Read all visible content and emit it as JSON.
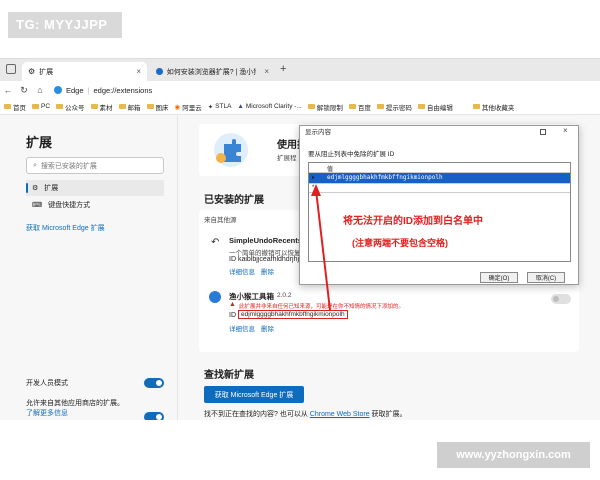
{
  "watermark_top": "TG: MYYJJPP",
  "watermark_bottom": "www.yyzhongxin.com",
  "tabs": [
    {
      "label": "扩展",
      "close": "×"
    },
    {
      "label": "如何安装浏览器扩展? | 渔小猴",
      "close": "×"
    }
  ],
  "new_tab": "+",
  "address": {
    "edge_label": "Edge",
    "url": "edge://extensions"
  },
  "favorites": [
    "首页",
    "PC",
    "公众号",
    "素材",
    "邮箱",
    "图床",
    "阿里云",
    "STLA",
    "Microsoft Clarity -...",
    "解锁限制",
    "百度",
    "提示密码",
    "自由编辑",
    "其他收藏夹"
  ],
  "sidebar": {
    "title": "扩展",
    "search_placeholder": "搜索已安装的扩展",
    "items": [
      {
        "label": "扩展"
      },
      {
        "label": "键盘快捷方式"
      }
    ],
    "get_link": "获取 Microsoft Edge 扩展",
    "dev_mode": "开发人员模式",
    "allow_other_stores": "允许来自其他应用商店的扩展。",
    "learn_more": "了解更多信息"
  },
  "main": {
    "promo_title": "使用扩",
    "promo_sub": "扩展程",
    "installed_title": "已安装的扩展",
    "from_other_sources": "来自其他源",
    "ext1": {
      "name": "SimpleUndoRecents",
      "version": "1.",
      "desc": "一个简单的撤销可以恢复",
      "id": "ID kaiblbjjceafhldhdrjhj",
      "details": "详细信息",
      "remove": "删除"
    },
    "ext2": {
      "name": "渔小猴工具箱",
      "version": "2.0.2",
      "warning": "此扩展并非来自任何已知来源，可能是在你不知情的情况下添加的。",
      "id_label": "ID",
      "id": "edjmlggggbhakhfmkbffngikmionpolh",
      "details": "详细信息",
      "remove": "删除"
    },
    "find_title": "查找新扩展",
    "get_button": "获取 Microsoft Edge 扩展",
    "cant_find_prefix": "找不到正在查找的内容? 也可以从",
    "chrome_store": "Chrome Web Store",
    "cant_find_suffix": "获取扩展。"
  },
  "dialog": {
    "title": "显示内容",
    "prompt": "要从阻止列表中免除的扩展 ID",
    "column": "值",
    "rows": [
      {
        "marker": "▸",
        "value": "edjmlggggbhakhfmkbffngikmionpolh"
      },
      {
        "marker": "*",
        "value": ""
      }
    ],
    "ok": "确定(O)",
    "cancel": "取消(C)"
  },
  "annotation": {
    "line1": "将无法开启的ID添加到白名单中",
    "line2": "(注意两端不要包含空格)"
  },
  "colors": {
    "accent": "#0f6cbd",
    "annotation": "#e02020"
  }
}
